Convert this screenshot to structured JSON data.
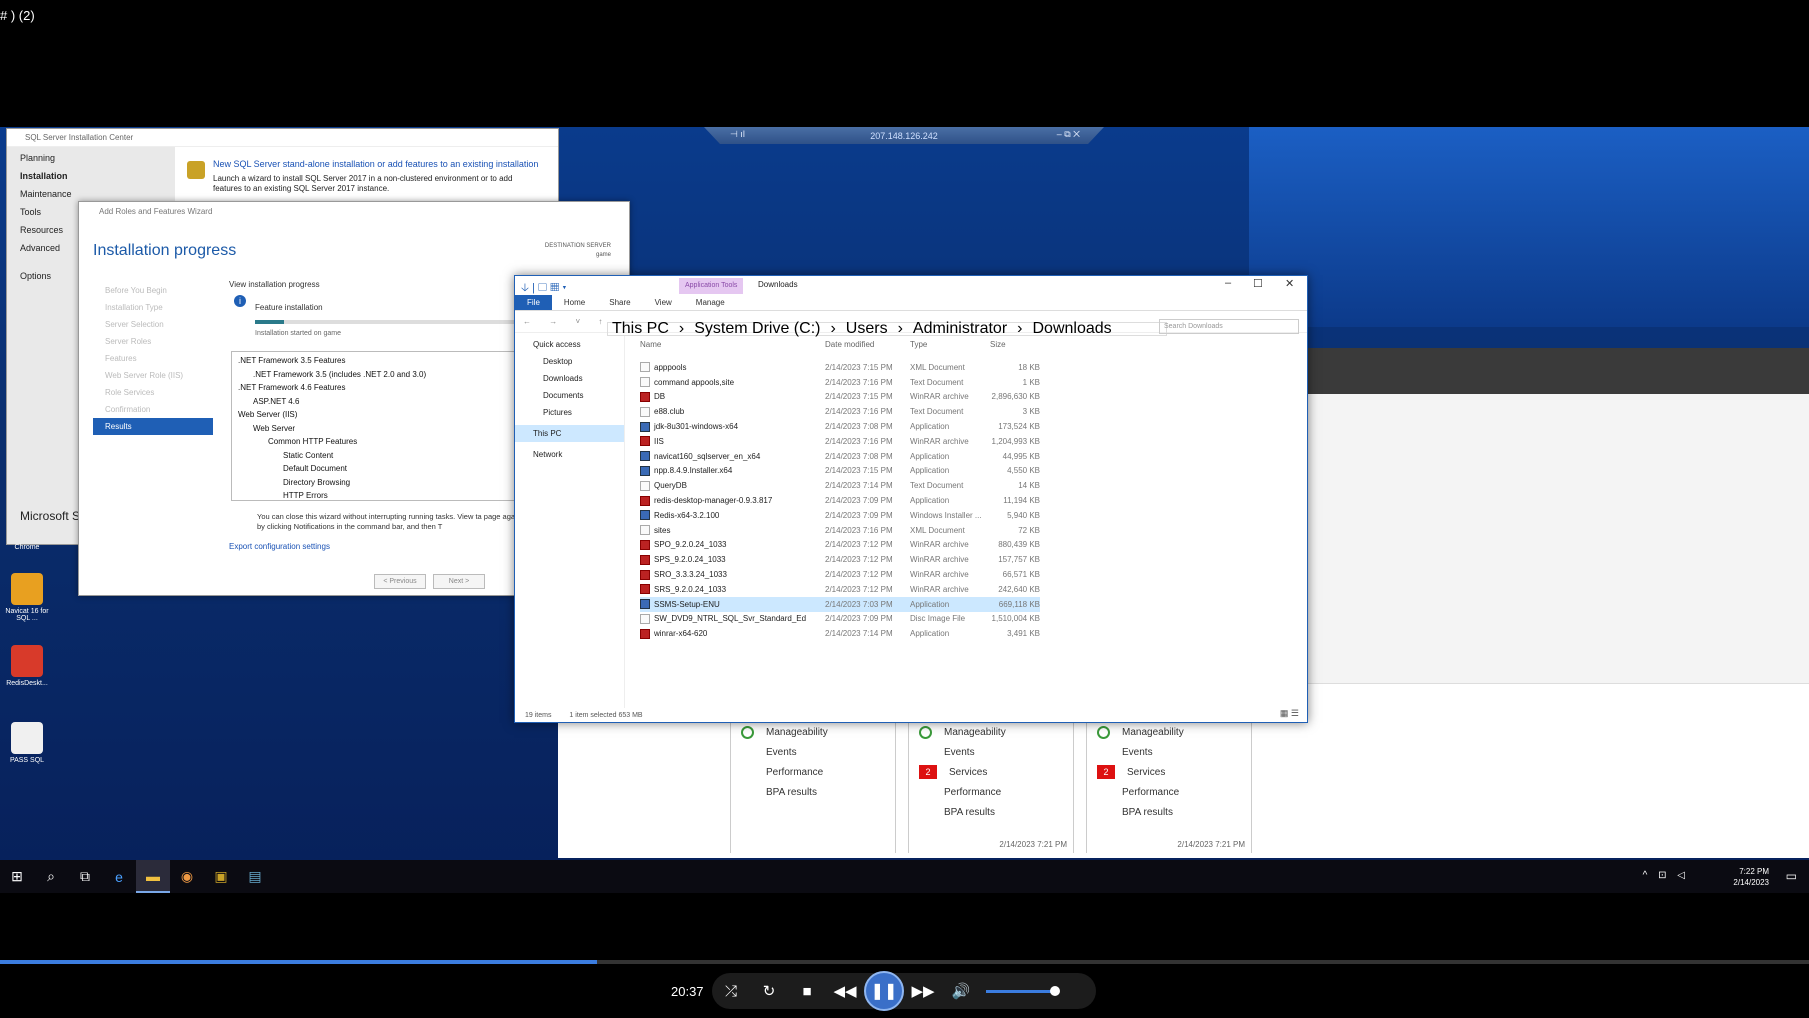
{
  "window_title": "# ) (2)",
  "rdp": {
    "host": "207.148.126.242"
  },
  "sql_center": {
    "title": "SQL Server Installation Center",
    "nav": [
      "Planning",
      "Installation",
      "Maintenance",
      "Tools",
      "Resources",
      "Advanced",
      "Options"
    ],
    "selected": "Installation",
    "link": "New SQL Server stand-alone installation or add features to an existing installation",
    "desc": "Launch a wizard to install SQL Server 2017 in a non-clustered environment or to add features to an existing SQL Server 2017 instance.",
    "brand": "Microsoft S"
  },
  "wizard": {
    "window_title": "Add Roles and Features Wizard",
    "title": "Installation progress",
    "dest_label": "DESTINATION SERVER",
    "dest_value": "game",
    "steps": [
      "Before You Begin",
      "Installation Type",
      "Server Selection",
      "Server Roles",
      "Features",
      "Web Server Role (IIS)",
      "Role Services",
      "Confirmation",
      "Results"
    ],
    "active_step": "Results",
    "view_label": "View installation progress",
    "feature_label": "Feature installation",
    "progress": 0.11,
    "started": "Installation started on game",
    "tree": [
      {
        "t": ".NET Framework 3.5 Features",
        "l": 0
      },
      {
        "t": ".NET Framework 3.5 (includes .NET 2.0 and 3.0)",
        "l": 1
      },
      {
        "t": ".NET Framework 4.6 Features",
        "l": 0
      },
      {
        "t": "ASP.NET 4.6",
        "l": 1
      },
      {
        "t": "Web Server (IIS)",
        "l": 0
      },
      {
        "t": "Web Server",
        "l": 1
      },
      {
        "t": "Common HTTP Features",
        "l": 2
      },
      {
        "t": "Static Content",
        "l": 3
      },
      {
        "t": "Default Document",
        "l": 3
      },
      {
        "t": "Directory Browsing",
        "l": 3
      },
      {
        "t": "HTTP Errors",
        "l": 3
      }
    ],
    "note": "You can close this wizard without interrupting running tasks. View ta page again by clicking Notifications in the command bar, and then T",
    "export": "Export configuration settings",
    "prev": "< Previous",
    "next": "Next >"
  },
  "explorer": {
    "app_tools": "Application Tools",
    "title": "Downloads",
    "tabs": [
      "File",
      "Home",
      "Share",
      "View",
      "Manage"
    ],
    "breadcrumb": [
      "This PC",
      "System Drive (C:)",
      "Users",
      "Administrator",
      "Downloads"
    ],
    "search_placeholder": "Search Downloads",
    "nav": [
      "Quick access",
      "Desktop",
      "Downloads",
      "Documents",
      "Pictures",
      "This PC",
      "Network"
    ],
    "columns": [
      "Name",
      "Date modified",
      "Type",
      "Size"
    ],
    "files": [
      {
        "name": "apppools",
        "date": "2/14/2023 7:15 PM",
        "type": "XML Document",
        "size": "18 KB",
        "icon": "doc"
      },
      {
        "name": "command appools,site",
        "date": "2/14/2023 7:16 PM",
        "type": "Text Document",
        "size": "1 KB",
        "icon": "doc"
      },
      {
        "name": "DB",
        "date": "2/14/2023 7:15 PM",
        "type": "WinRAR archive",
        "size": "2,896,630 KB",
        "icon": "rar"
      },
      {
        "name": "e88.club",
        "date": "2/14/2023 7:16 PM",
        "type": "Text Document",
        "size": "3 KB",
        "icon": "doc"
      },
      {
        "name": "jdk-8u301-windows-x64",
        "date": "2/14/2023 7:08 PM",
        "type": "Application",
        "size": "173,524 KB",
        "icon": "app"
      },
      {
        "name": "IIS",
        "date": "2/14/2023 7:16 PM",
        "type": "WinRAR archive",
        "size": "1,204,993 KB",
        "icon": "rar"
      },
      {
        "name": "navicat160_sqlserver_en_x64",
        "date": "2/14/2023 7:08 PM",
        "type": "Application",
        "size": "44,995 KB",
        "icon": "app"
      },
      {
        "name": "npp.8.4.9.Installer.x64",
        "date": "2/14/2023 7:15 PM",
        "type": "Application",
        "size": "4,550 KB",
        "icon": "app"
      },
      {
        "name": "QueryDB",
        "date": "2/14/2023 7:14 PM",
        "type": "Text Document",
        "size": "14 KB",
        "icon": "doc"
      },
      {
        "name": "redis-desktop-manager-0.9.3.817",
        "date": "2/14/2023 7:09 PM",
        "type": "Application",
        "size": "11,194 KB",
        "icon": "rar"
      },
      {
        "name": "Redis-x64-3.2.100",
        "date": "2/14/2023 7:09 PM",
        "type": "Windows Installer ...",
        "size": "5,940 KB",
        "icon": "app"
      },
      {
        "name": "sites",
        "date": "2/14/2023 7:16 PM",
        "type": "XML Document",
        "size": "72 KB",
        "icon": "doc"
      },
      {
        "name": "SPO_9.2.0.24_1033",
        "date": "2/14/2023 7:12 PM",
        "type": "WinRAR archive",
        "size": "880,439 KB",
        "icon": "rar"
      },
      {
        "name": "SPS_9.2.0.24_1033",
        "date": "2/14/2023 7:12 PM",
        "type": "WinRAR archive",
        "size": "157,757 KB",
        "icon": "rar"
      },
      {
        "name": "SRO_3.3.3.24_1033",
        "date": "2/14/2023 7:12 PM",
        "type": "WinRAR archive",
        "size": "66,571 KB",
        "icon": "rar"
      },
      {
        "name": "SRS_9.2.0.24_1033",
        "date": "2/14/2023 7:12 PM",
        "type": "WinRAR archive",
        "size": "242,640 KB",
        "icon": "rar"
      },
      {
        "name": "SSMS-Setup-ENU",
        "date": "2/14/2023 7:03 PM",
        "type": "Application",
        "size": "669,118 KB",
        "icon": "app",
        "selected": true
      },
      {
        "name": "SW_DVD9_NTRL_SQL_Svr_Standard_Ed",
        "date": "2/14/2023 7:09 PM",
        "type": "Disc Image File",
        "size": "1,510,004 KB",
        "icon": "doc"
      },
      {
        "name": "winrar-x64-620",
        "date": "2/14/2023 7:14 PM",
        "type": "Application",
        "size": "3,491 KB",
        "icon": "rar"
      }
    ],
    "status_items": "19 items",
    "status_selected": "1 item selected  653 MB"
  },
  "tiles": [
    {
      "rows": [
        {
          "k": "ok",
          "t": "Manageability"
        },
        {
          "k": "",
          "t": "Events"
        },
        {
          "k": "",
          "t": "Performance"
        },
        {
          "k": "",
          "t": "BPA results"
        }
      ],
      "ts": ""
    },
    {
      "rows": [
        {
          "k": "ok",
          "t": "Manageability"
        },
        {
          "k": "",
          "t": "Events"
        },
        {
          "k": "2",
          "t": "Services"
        },
        {
          "k": "",
          "t": "Performance"
        },
        {
          "k": "",
          "t": "BPA results"
        }
      ],
      "ts": "2/14/2023 7:21 PM"
    },
    {
      "rows": [
        {
          "k": "ok",
          "t": "Manageability"
        },
        {
          "k": "",
          "t": "Events"
        },
        {
          "k": "2",
          "t": "Services"
        },
        {
          "k": "",
          "t": "Performance"
        },
        {
          "k": "",
          "t": "BPA results"
        }
      ],
      "ts": "2/14/2023 7:21 PM"
    }
  ],
  "desktop_icons": [
    {
      "label": "Chrome",
      "color": ""
    },
    {
      "label": "Navicat 16 for SQL ...",
      "color": "#e8a020"
    },
    {
      "label": "RedisDeskt...",
      "color": "#d83a2a"
    },
    {
      "label": "PASS SQL",
      "color": "#f0f0f0"
    }
  ],
  "taskbar": {
    "time": "7:22 PM",
    "date": "2/14/2023"
  },
  "player": {
    "time": "20:37",
    "progress": 0.33,
    "volume": 0.75
  }
}
